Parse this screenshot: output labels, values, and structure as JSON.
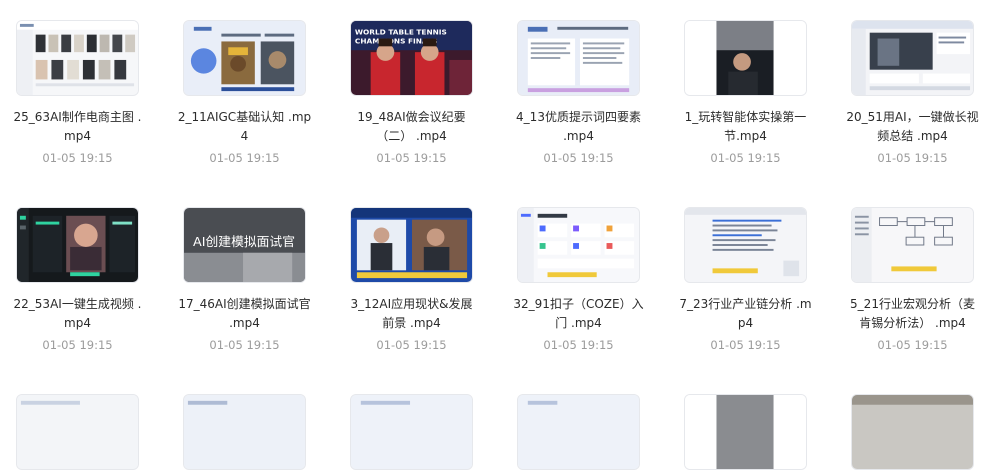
{
  "files": [
    {
      "name": "25_63AI制作电商主图 .\nmp4",
      "time": "01-05 19:15",
      "thumb": "ecommerce-grid"
    },
    {
      "name": "2_11AIGC基础认知 .mp\n4",
      "time": "01-05 19:15",
      "thumb": "aigc-slide"
    },
    {
      "name": "19_48AI做会议纪要\n（二） .mp4",
      "time": "01-05 19:15",
      "thumb": "table-tennis-finals",
      "overlay": "WORLD TABLE TENNIS\nCHAMPIONS FINALS"
    },
    {
      "name": "4_13优质提示词四要素\n.mp4",
      "time": "01-05 19:15",
      "thumb": "prompt-doc"
    },
    {
      "name": "1_玩转智能体实操第一\n节.mp4",
      "time": "01-05 19:15",
      "thumb": "webcam-speaker"
    },
    {
      "name": "20_51用AI，一键做长视\n频总结 .mp4",
      "time": "01-05 19:15",
      "thumb": "video-summary-web"
    },
    {
      "name": "22_53AI一键生成视频 .\nmp4",
      "time": "01-05 19:15",
      "thumb": "ai-video-dark"
    },
    {
      "name": "17_46AI创建模拟面试官\n.mp4",
      "time": "01-05 19:15",
      "thumb": "interview-banner",
      "overlay": "AI创建模拟面试官"
    },
    {
      "name": "3_12AI应用现状&发展\n前景 .mp4",
      "time": "01-05 19:15",
      "thumb": "news-broadcast"
    },
    {
      "name": "32_91扣子（COZE）入\n门 .mp4",
      "time": "01-05 19:15",
      "thumb": "coze-dashboard"
    },
    {
      "name": "7_23行业产业链分析 .m\np4",
      "time": "01-05 19:15",
      "thumb": "industry-chain"
    },
    {
      "name": "5_21行业宏观分析（麦\n肯锡分析法） .mp4",
      "time": "01-05 19:15",
      "thumb": "macro-analysis"
    },
    {
      "name": "",
      "time": "",
      "thumb": "partial-1"
    },
    {
      "name": "",
      "time": "",
      "thumb": "partial-2"
    },
    {
      "name": "",
      "time": "",
      "thumb": "partial-3"
    },
    {
      "name": "",
      "time": "",
      "thumb": "partial-4"
    },
    {
      "name": "",
      "time": "",
      "thumb": "partial-5"
    },
    {
      "name": "",
      "time": "",
      "thumb": "partial-6"
    }
  ]
}
